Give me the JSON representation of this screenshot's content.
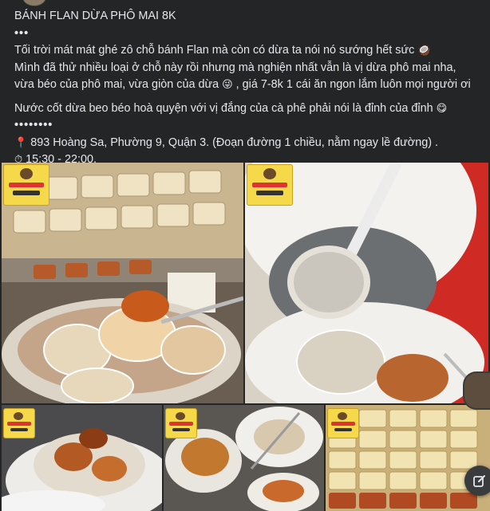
{
  "post": {
    "title": "BÁNH FLAN DỪA PHÔ MAI 8K",
    "dots": "•••",
    "para1_line1": "Tối trời mát mát ghé zô chỗ bánh Flan mà còn có dừa ta nói nó sướng hết sức",
    "para1_line2": "Mình đã thử nhiều loại ở chỗ này rồi nhưng mà nghiện nhất vẫn là vị dừa phô mai nha,",
    "para1_line3a": "vừa béo của phô mai, vừa giòn của dừa",
    "para1_line3b": ", giá 7-8k 1 cái ăn ngon lắm luôn mọi người ơi",
    "para2": "Nước cốt dừa beo béo hoà quyện với vị đắng của cà phê phải nói là đỉnh của đỉnh",
    "dots2": "••••••••",
    "address": "893 Hoàng Sa, Phường 9, Quận 3. (Đoạn đường 1 chiều, nằm ngay lề đường) .",
    "hours": "15:30 - 22:00."
  },
  "icons": {
    "coconut": "coconut-icon",
    "smile_tongue": "face-tongue-icon",
    "smile_yum": "face-yum-icon",
    "pin": "pin-icon",
    "clock": "stopwatch-icon",
    "edit": "edit-icon"
  },
  "colors": {
    "background": "#242526",
    "text": "#e4e6eb",
    "badge": "#f5d94a"
  }
}
